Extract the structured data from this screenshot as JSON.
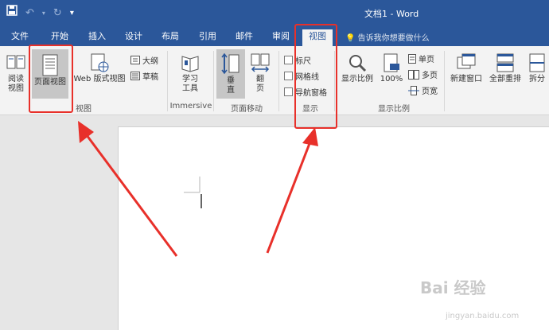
{
  "titlebar": {
    "document_title": "文档1 - Word",
    "qat": {
      "save_icon": "save-icon",
      "undo_icon": "undo-icon",
      "redo_icon": "redo-icon",
      "customize_icon": "customize-icon"
    }
  },
  "tabs": [
    {
      "label": "文件"
    },
    {
      "label": "开始"
    },
    {
      "label": "插入"
    },
    {
      "label": "设计"
    },
    {
      "label": "布局"
    },
    {
      "label": "引用"
    },
    {
      "label": "邮件"
    },
    {
      "label": "审阅"
    },
    {
      "label": "视图",
      "active": true
    }
  ],
  "tell_me": {
    "icon": "lightbulb-icon",
    "text": "告诉我你想要做什么"
  },
  "ribbon": {
    "views": {
      "group_label": "视图",
      "read_mode": "阅读\n视图",
      "print_layout": "页面视图",
      "web_layout": "Web 版式视图",
      "outline": "大纲",
      "draft": "草稿"
    },
    "immersive": {
      "group_label": "Immersive",
      "learning_tools": "学习\n工具"
    },
    "page_movement": {
      "group_label": "页面移动",
      "vertical": "垂\n直",
      "side_to_side": "翻\n页"
    },
    "show": {
      "group_label": "显示",
      "ruler": "标尺",
      "gridlines": "网格线",
      "navigation_pane": "导航窗格"
    },
    "zoom": {
      "group_label": "显示比例",
      "zoom": "显示比例",
      "hundred": "100%",
      "one_page": "单页",
      "multiple_pages": "多页",
      "page_width": "页宽"
    },
    "window": {
      "new_window": "新建窗口",
      "arrange_all": "全部重排",
      "split": "拆分"
    }
  },
  "colors": {
    "brand": "#2b579a",
    "highlight": "#e8302a"
  },
  "watermark": {
    "main": "Bai 经验",
    "sub": "jingyan.baidu.com"
  }
}
